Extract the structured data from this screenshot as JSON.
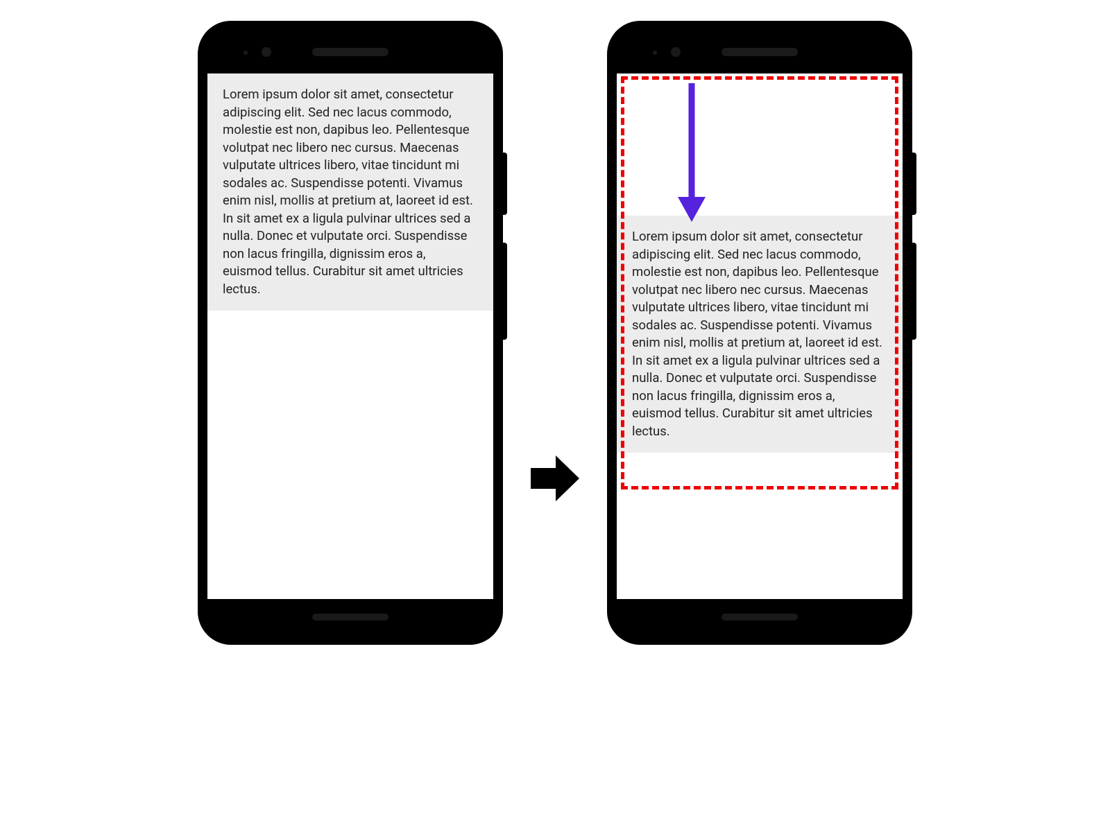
{
  "diagram": {
    "lorem_text": "Lorem ipsum dolor sit amet, consectetur adipiscing elit. Sed nec lacus commodo, molestie est non, dapibus leo. Pellentesque volutpat nec libero nec cursus. Maecenas vulputate ultrices libero, vitae tincidunt mi sodales ac. Suspendisse potenti. Vivamus enim nisl, mollis at pretium at, laoreet id est. In sit amet ex a ligula pulvinar ultrices sed a nulla. Donec et vulputate orci. Suspendisse non lacus fringilla, dignissim eros a, euismod tellus. Curabitur sit amet ultricies lectus.",
    "colors": {
      "dashed_border": "#ee0000",
      "scroll_arrow": "#5522dd",
      "transition_arrow": "#000000",
      "text_bg": "#ececec"
    }
  }
}
